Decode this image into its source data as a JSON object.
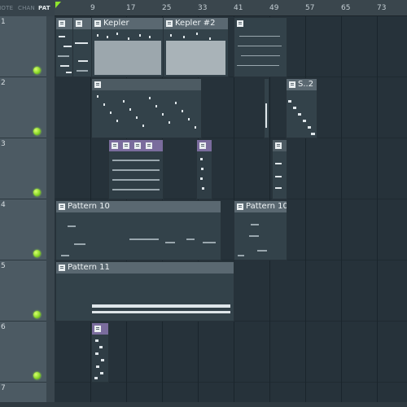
{
  "panel_tabs": {
    "note": "NOTE",
    "chan": "CHAN",
    "pat": "PAT"
  },
  "ruler": {
    "bars": [
      "9",
      "17",
      "25",
      "33",
      "41",
      "49",
      "57",
      "65",
      "73"
    ]
  },
  "tracks": [
    {
      "number": "1"
    },
    {
      "number": "2"
    },
    {
      "number": "3"
    },
    {
      "number": "4"
    },
    {
      "number": "5"
    },
    {
      "number": "6"
    },
    {
      "number": "7"
    }
  ],
  "clips": {
    "kepler": "Kepler",
    "kepler2": "Kepler #2",
    "s2": "S..2",
    "pattern10a": "Pattern 10",
    "pattern10b": "Pattern 10",
    "pattern11": "Pattern 11"
  },
  "colors": {
    "led": "#8bd82a",
    "playhead": "#8fe52d",
    "clip_header": "#5a6871",
    "clip_header_purple": "#7a6c9d"
  }
}
